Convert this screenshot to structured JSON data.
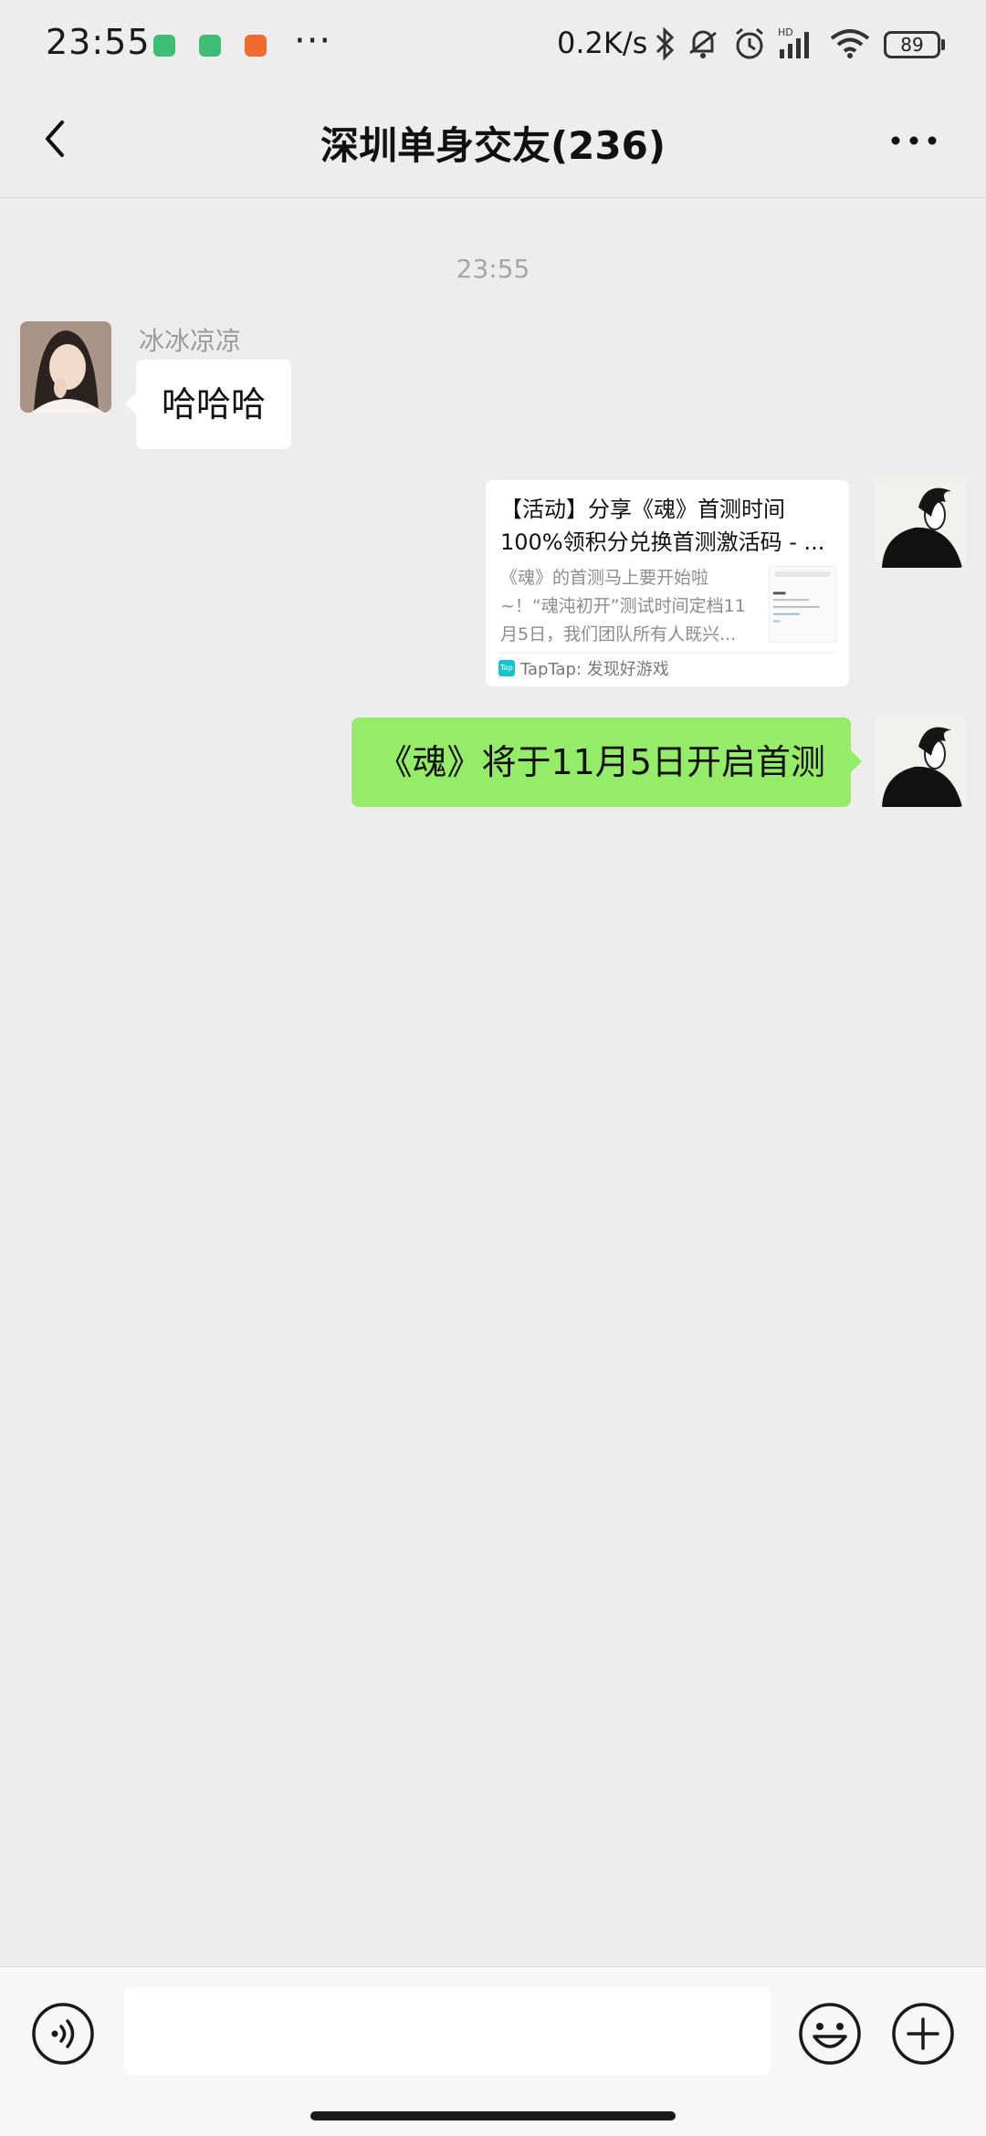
{
  "status_bar": {
    "time": "23:55",
    "network_speed": "0.2K/s",
    "battery": "89",
    "notification_icons": [
      "app-notification-icon",
      "message-notification-icon",
      "shield-notification-icon"
    ],
    "more": "···",
    "icons": [
      "bluetooth-icon",
      "mute-bell-icon",
      "alarm-icon",
      "signal-hd-icon",
      "wifi-icon",
      "battery-icon"
    ]
  },
  "header": {
    "title": "深圳单身交友(236)"
  },
  "chat": {
    "timestamp": "23:55",
    "messages": [
      {
        "side": "left",
        "sender": "冰冰凉凉",
        "text": "哈哈哈"
      },
      {
        "side": "right",
        "type": "link-card",
        "title": "【活动】分享《魂》首测时间100%领积分兑换首测激活码 - ...",
        "description": "《魂》的首测马上要开始啦~！“魂沌初开”测试时间定档11月5日，我们团队所有人既兴...",
        "source": "TapTap: 发现好游戏",
        "source_logo": "Tap"
      },
      {
        "side": "right",
        "text": "《魂》将于11月5日开启首测"
      }
    ]
  },
  "input_bar": {
    "placeholder": "",
    "value": ""
  },
  "colors": {
    "background": "#ededed",
    "bubble_self": "#95ec69",
    "bubble_other": "#ffffff",
    "link_logo": "#15c5ce"
  }
}
